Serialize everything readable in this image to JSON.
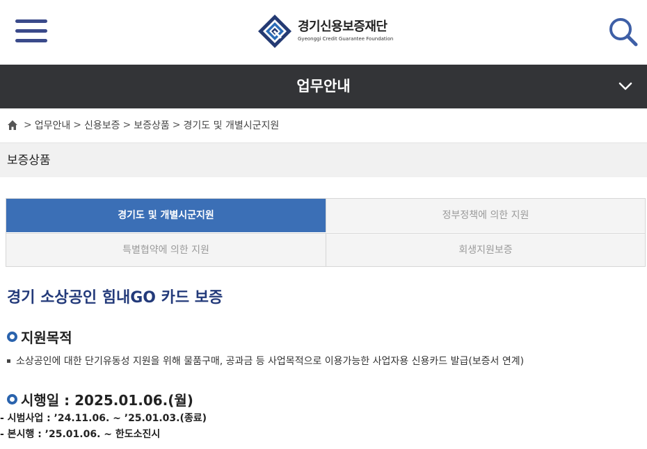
{
  "header": {
    "logo_name": "경기신용보증재단",
    "logo_english": "Gyeonggi Credit Guarantee Foundation",
    "menu_icon": "hamburger-icon",
    "search_icon": "search-icon"
  },
  "menu_bar": {
    "title": "업무안내",
    "toggle_icon": "chevron-down-icon"
  },
  "breadcrumb": {
    "home_icon": "home-icon",
    "separator": ">",
    "items": [
      "업무안내",
      "신용보증",
      "보증상품",
      "경기도 및 개별시군지원"
    ]
  },
  "section": {
    "label": "보증상품"
  },
  "tabs": [
    {
      "label": "경기도 및 개별시군지원",
      "active": true
    },
    {
      "label": "정부정책에 의한 지원",
      "active": false
    },
    {
      "label": "특별협약에 의한 지원",
      "active": false
    },
    {
      "label": "회생지원보증",
      "active": false
    }
  ],
  "content": {
    "title": "경기 소상공인 힘내GO 카드 보증",
    "purpose_heading": "지원목적",
    "purpose_text": "소상공인에 대한 단기유동성 지원을 위해 물품구매, 공과금 등 사업목적으로 이용가능한 사업자용 신용카드 발급(보증서 연계)",
    "date_heading": "시행일 : 2025.01.06.(월)",
    "schedule": [
      "- 시범사업 : ’24.11.06. ~ ’25.01.03.(종료)",
      "- 본시행 : ’25.01.06. ~ 한도소진시"
    ]
  },
  "colors": {
    "menu_bar_bg": "#333437",
    "active_tab_bg": "#3b6fb6",
    "title_color": "#233a7a",
    "bullet_color": "#2a63ad",
    "logo_blue": "#2b4f8e"
  }
}
